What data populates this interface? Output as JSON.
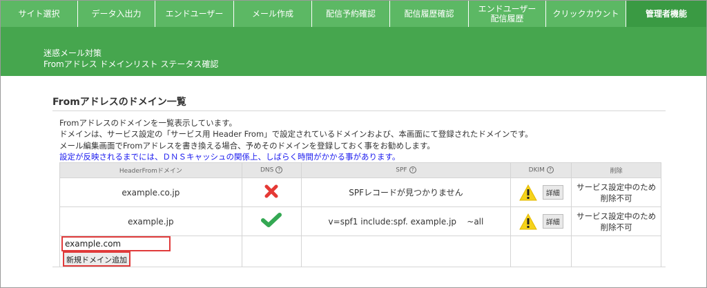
{
  "nav": {
    "items": [
      {
        "label": "サイト選択"
      },
      {
        "label": "データ入出力"
      },
      {
        "label": "エンドユーザー"
      },
      {
        "label": "メール作成"
      },
      {
        "label": "配信予約確認"
      },
      {
        "label": "配信履歴確認"
      },
      {
        "label": "エンドユーザー\n配信履歴"
      },
      {
        "label": "クリックカウント"
      },
      {
        "label": "管理者機能",
        "active": true
      }
    ]
  },
  "banner": {
    "line1": "迷惑メール対策",
    "line2": "Fromアドレス ドメインリスト ステータス確認"
  },
  "section": {
    "title": "Fromアドレスのドメイン一覧",
    "desc1": "Fromアドレスのドメインを一覧表示しています。",
    "desc2": "ドメインは、サービス設定の「サービス用 Header From」で設定されているドメインおよび、本画面にて登録されたドメインです。",
    "desc3": "メール編集画面でFromアドレスを書き換える場合、予めそのドメインを登録しておく事をお勧めします。",
    "desc4": "設定が反映されるまでには、ＤＮＳキャッシュの関係上、しばらく時間がかかる事があります。"
  },
  "table": {
    "headers": {
      "domain": "HeaderFromドメイン",
      "dns": "DNS",
      "spf": "SPF",
      "dkim": "DKIM",
      "delete": "削除"
    },
    "rows": [
      {
        "domain": "example.co.jp",
        "dns_status": "cross-icon",
        "spf": "SPFレコードが見つかりません",
        "dkim_status": "warning-icon",
        "detail_label": "詳細",
        "delete_line1": "サービス設定中のため",
        "delete_line2": "削除不可"
      },
      {
        "domain": "example.jp",
        "dns_status": "check-icon",
        "spf": "v=spf1 include:spf. example.jp    ~all",
        "dkim_status": "warning-icon",
        "detail_label": "詳細",
        "delete_line1": "サービス設定中のため",
        "delete_line2": "削除不可"
      }
    ],
    "help_glyph": "?"
  },
  "add_form": {
    "input_value": "example.com",
    "button_label": "新規ドメイン追加"
  },
  "colors": {
    "nav_bg": "#5cb864",
    "nav_active": "#3a9a43",
    "banner_bg": "#46a64e",
    "error_red": "#e53935",
    "ok_green": "#34a853",
    "warn_yellow": "#f5d21b",
    "highlight_red": "#e03a3a",
    "note_blue": "#1a1aee"
  }
}
